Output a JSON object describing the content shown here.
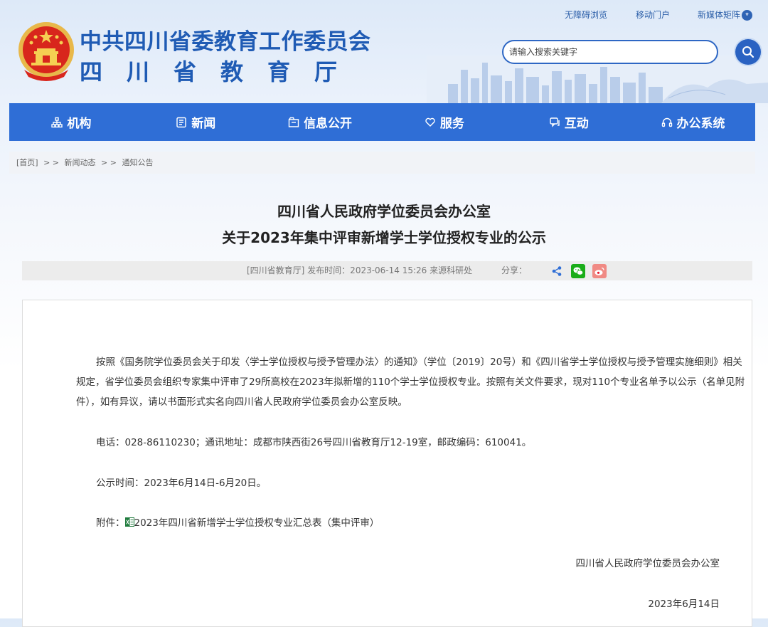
{
  "header": {
    "title": "中共四川省委教育工作委员会",
    "subtitle": "四川省教育厅",
    "top_links": [
      "无障碍浏览",
      "移动门户",
      "新媒体矩阵"
    ],
    "search_placeholder": "请输入搜索关键字"
  },
  "nav": {
    "items": [
      {
        "label": "机构",
        "icon": "org-chart-icon"
      },
      {
        "label": "新闻",
        "icon": "newspaper-icon"
      },
      {
        "label": "信息公开",
        "icon": "folder-icon"
      },
      {
        "label": "服务",
        "icon": "hand-heart-icon"
      },
      {
        "label": "互动",
        "icon": "chat-icon"
      },
      {
        "label": "办公系统",
        "icon": "headset-icon"
      }
    ]
  },
  "breadcrumb": {
    "home": "[首页]",
    "sep1": "> >",
    "level1": "新闻动态",
    "sep2": "> >",
    "level2": "通知公告"
  },
  "article": {
    "title_line1": "四川省人民政府学位委员会办公室",
    "title_line2": "关于2023年集中评审新增学士学位授权专业的公示",
    "meta": "[四川省教育厅]   发布时间：2023-06-14 15:26   来源科研处",
    "share_label": "分享：",
    "share_icons": [
      "share-icon",
      "wechat-icon",
      "weibo-icon"
    ],
    "paragraph1": "按照《国务院学位委员会关于印发〈学士学位授权与授予管理办法〉的通知》（学位〔2019〕20号）和《四川省学士学位授权与授予管理实施细则》相关规定，省学位委员会组织专家集中评审了29所高校在2023年拟新增的110个学士学位授权专业。按照有关文件要求，现对110个专业名单予以公示（名单见附件），如有异议，请以书面形式实名向四川省人民政府学位委员会办公室反映。",
    "contact": "电话：028-86110230；通讯地址：成都市陕西街26号四川省教育厅12-19室，邮政编码：610041。",
    "period": "公示时间：2023年6月14日-6月20日。",
    "attachment_label": "附件：",
    "attachment_name": "2023年四川省新增学士学位授权专业汇总表（集中评审）",
    "signature": "四川省人民政府学位委员会办公室",
    "date": "2023年6月14日"
  },
  "colors": {
    "brand_blue": "#2f6ed6",
    "title_blue": "#1f5bb4",
    "wechat_green": "#1aad19",
    "weibo_red": "#e6162d"
  }
}
